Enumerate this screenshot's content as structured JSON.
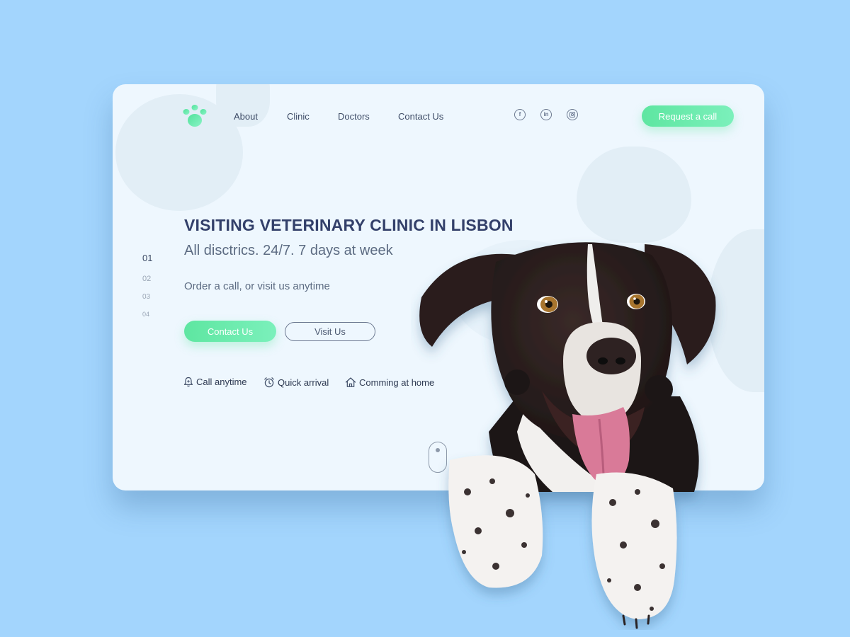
{
  "header": {
    "nav": [
      "About",
      "Clinic",
      "Doctors",
      "Contact Us"
    ],
    "social": [
      "facebook-icon",
      "linkedin-icon",
      "instagram-icon"
    ],
    "social_glyphs": {
      "facebook": "f",
      "linkedin": "in"
    },
    "request_label": "Request a call"
  },
  "hero": {
    "title": "VISITING VETERINARY CLINIC IN LISBON",
    "subtitle": "All disctrics. 24/7. 7 days at week",
    "description": "Order a call, or visit us anytime",
    "contact_label": "Contact Us",
    "visit_label": "Visit Us"
  },
  "pager": [
    "01",
    "02",
    "03",
    "04"
  ],
  "features": [
    {
      "icon": "bell-icon",
      "label": "Call anytime"
    },
    {
      "icon": "alarm-clock-icon",
      "label": "Quick arrival"
    },
    {
      "icon": "house-icon",
      "label": "Comming at home"
    }
  ],
  "colors": {
    "background": "#a3d5fd",
    "card": "#eef7fe",
    "accent": "#5ee6a1",
    "heading": "#33406a",
    "text": "#5c6b82"
  }
}
